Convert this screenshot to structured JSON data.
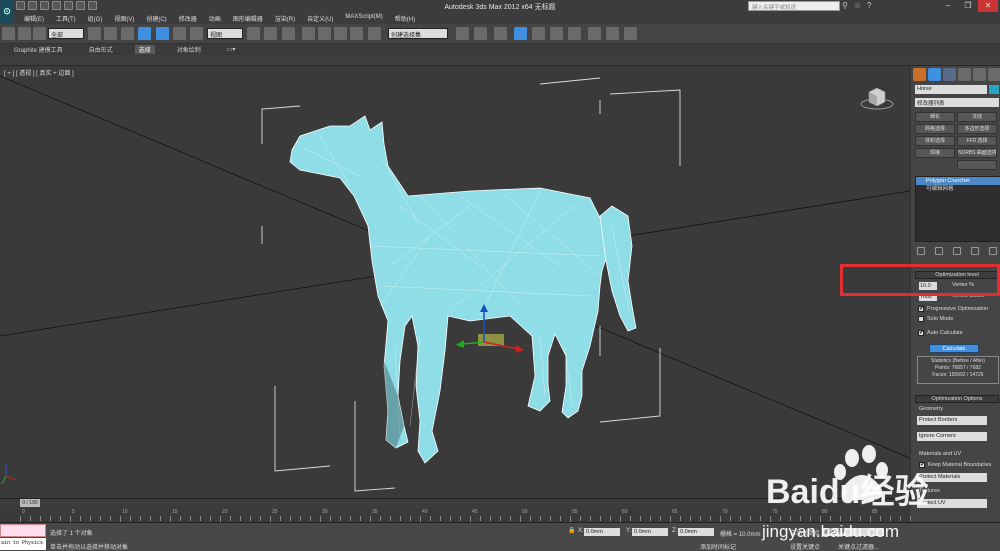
{
  "window": {
    "title": "Autodesk 3ds Max  2012 x64      无标题",
    "search_placeholder": "键入关键字或短语",
    "app_icon": "3ds-max-icon"
  },
  "menu": [
    "编辑(E)",
    "工具(T)",
    "组(G)",
    "视图(V)",
    "创建(C)",
    "修改器",
    "动画",
    "图形编辑器",
    "渲染(R)",
    "自定义(U)",
    "MAXScript(M)",
    "帮助(H)"
  ],
  "toolbar": {
    "selection_filter": "全部",
    "reference_coord": "视图",
    "named_selection": "创建选择集"
  },
  "ribbon": {
    "tabs": [
      "Graphite 建模工具",
      "自由形式",
      "选择",
      "对象绘制"
    ],
    "active": "选择"
  },
  "viewport": {
    "label": "[ + ] [ 透视 ] [ 真实 + 边面 ]"
  },
  "command_panel": {
    "object_name": "Horse",
    "modifier_list": "修改器列表",
    "buttons": [
      [
        "细化",
        "法线"
      ],
      [
        "网格选择",
        "多边形选择"
      ],
      [
        "体积选择",
        "FFD 选择"
      ],
      [
        "焊接",
        "NURBS 曲面选择"
      ]
    ],
    "stack": [
      {
        "label": "Polygon Cruncher",
        "selected": true
      },
      {
        "label": "可编辑网格",
        "selected": false
      }
    ],
    "optimization_level": {
      "header": "Optimization level",
      "vertex_pct": "10.0",
      "vertex_pct_label": "Vertex %",
      "vertex_count": "7682",
      "vertex_count_label": "Vertex Count",
      "progressive": "Progressive Optimization",
      "solo": "Solo Mode",
      "auto_calc": "Auto Calculate",
      "calculate": "Calculate",
      "stats_title": "Statistics (Before / After)",
      "points": "Points: 76857 / 7682",
      "faces": "Faces: 150992 / 14726"
    },
    "optimization_options": {
      "header": "Optimization Options",
      "geometry_label": "Geometry",
      "protect_borders": "Protect Borders",
      "ignore_corners": "Ignore Corners",
      "materials_label": "Materials and UV",
      "keep_mat_boundaries": "Keep Material Boundaries",
      "protect_materials": "Protect Materials",
      "textures_label": "Textures",
      "protect_uv": "Protect UV",
      "tolerance": "Tolerance"
    }
  },
  "timeline": {
    "slider": "0 / 100",
    "ticks": [
      "0",
      "5",
      "10",
      "15",
      "20",
      "25",
      "30",
      "35",
      "40",
      "45",
      "50",
      "55",
      "60",
      "65",
      "70",
      "75",
      "80",
      "85"
    ]
  },
  "status": {
    "maxscript": "ain to Physics",
    "selected": "选择了 1 个对象",
    "prompt": "单击并拖动以选择并移动对象",
    "x": "0.0mm",
    "y": "0.0mm",
    "z": "0.0mm",
    "grid": "栅格 = 10.0mm",
    "auto_key": "自动关键点",
    "selected_obj": "选定对象",
    "set_key": "设置关键点",
    "key_filter": "关键点过滤器...",
    "add_time_tag": "添加时间标记"
  },
  "watermark": {
    "brand": "Baidu经验",
    "url": "jingyan.baidu.com"
  },
  "colors": {
    "mesh": "#8fdde6",
    "highlight": "#e23030",
    "accent": "#3f8ee0"
  }
}
